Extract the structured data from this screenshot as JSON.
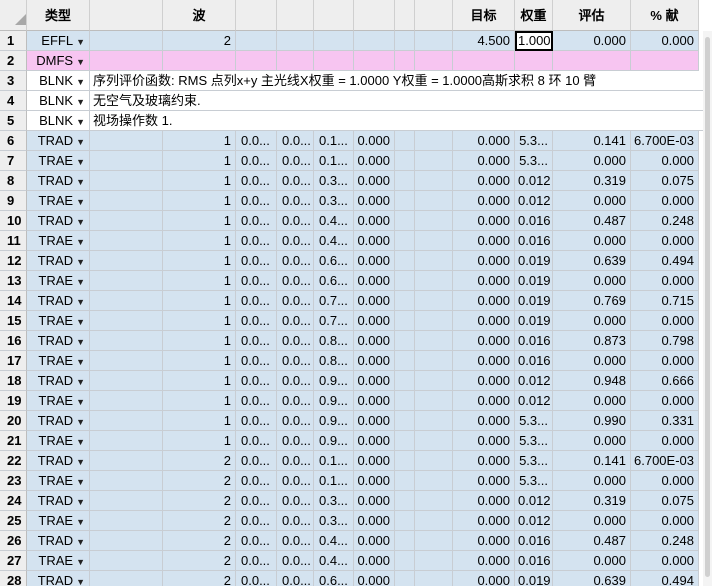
{
  "columns": {
    "type": "类型",
    "wave": "波",
    "target": "目标",
    "weight": "权重",
    "value": "评估",
    "contrib": "% 献"
  },
  "colors": {
    "header_bg": "#eeeeee",
    "operand_row_bg": "#d4e3f0",
    "effl_row_bg": "#d4e3f0",
    "dmfs_row_bg": "#f7c5f1",
    "blnk_row_bg": "#ffffff",
    "grid_line": "#c8cdd3"
  },
  "rows": [
    {
      "n": "1",
      "type": "EFFL",
      "style": "effl",
      "wave": "2",
      "c1": "",
      "c2": "",
      "c3": "",
      "c4": "",
      "target": "4.500",
      "weight": "1.000",
      "value": "0.000",
      "contrib": "0.000",
      "selected": "weight"
    },
    {
      "n": "2",
      "type": "DMFS",
      "style": "dmfs",
      "wave": "",
      "c1": "",
      "c2": "",
      "c3": "",
      "c4": "",
      "target": "",
      "weight": "",
      "value": "",
      "contrib": ""
    },
    {
      "n": "3",
      "type": "BLNK",
      "style": "blnk",
      "text": "序列评价函数: RMS 点列x+y 主光线X权重 = 1.0000 Y权重 = 1.0000高斯求积 8 环 10 臂"
    },
    {
      "n": "4",
      "type": "BLNK",
      "style": "blnk",
      "text": "无空气及玻璃约束."
    },
    {
      "n": "5",
      "type": "BLNK",
      "style": "blnk",
      "text": "视场操作数 1."
    },
    {
      "n": "6",
      "type": "TRAD",
      "style": "op",
      "wave": "1",
      "c1": "0.0...",
      "c2": "0.0...",
      "c3": "0.1...",
      "c4": "0.000",
      "target": "0.000",
      "weight": "5.3...",
      "value": "0.141",
      "contrib": "6.700E-03"
    },
    {
      "n": "7",
      "type": "TRAE",
      "style": "op",
      "wave": "1",
      "c1": "0.0...",
      "c2": "0.0...",
      "c3": "0.1...",
      "c4": "0.000",
      "target": "0.000",
      "weight": "5.3...",
      "value": "0.000",
      "contrib": "0.000"
    },
    {
      "n": "8",
      "type": "TRAD",
      "style": "op",
      "wave": "1",
      "c1": "0.0...",
      "c2": "0.0...",
      "c3": "0.3...",
      "c4": "0.000",
      "target": "0.000",
      "weight": "0.012",
      "value": "0.319",
      "contrib": "0.075"
    },
    {
      "n": "9",
      "type": "TRAE",
      "style": "op",
      "wave": "1",
      "c1": "0.0...",
      "c2": "0.0...",
      "c3": "0.3...",
      "c4": "0.000",
      "target": "0.000",
      "weight": "0.012",
      "value": "0.000",
      "contrib": "0.000"
    },
    {
      "n": "10",
      "type": "TRAD",
      "style": "op",
      "wave": "1",
      "c1": "0.0...",
      "c2": "0.0...",
      "c3": "0.4...",
      "c4": "0.000",
      "target": "0.000",
      "weight": "0.016",
      "value": "0.487",
      "contrib": "0.248"
    },
    {
      "n": "11",
      "type": "TRAE",
      "style": "op",
      "wave": "1",
      "c1": "0.0...",
      "c2": "0.0...",
      "c3": "0.4...",
      "c4": "0.000",
      "target": "0.000",
      "weight": "0.016",
      "value": "0.000",
      "contrib": "0.000"
    },
    {
      "n": "12",
      "type": "TRAD",
      "style": "op",
      "wave": "1",
      "c1": "0.0...",
      "c2": "0.0...",
      "c3": "0.6...",
      "c4": "0.000",
      "target": "0.000",
      "weight": "0.019",
      "value": "0.639",
      "contrib": "0.494"
    },
    {
      "n": "13",
      "type": "TRAE",
      "style": "op",
      "wave": "1",
      "c1": "0.0...",
      "c2": "0.0...",
      "c3": "0.6...",
      "c4": "0.000",
      "target": "0.000",
      "weight": "0.019",
      "value": "0.000",
      "contrib": "0.000"
    },
    {
      "n": "14",
      "type": "TRAD",
      "style": "op",
      "wave": "1",
      "c1": "0.0...",
      "c2": "0.0...",
      "c3": "0.7...",
      "c4": "0.000",
      "target": "0.000",
      "weight": "0.019",
      "value": "0.769",
      "contrib": "0.715"
    },
    {
      "n": "15",
      "type": "TRAE",
      "style": "op",
      "wave": "1",
      "c1": "0.0...",
      "c2": "0.0...",
      "c3": "0.7...",
      "c4": "0.000",
      "target": "0.000",
      "weight": "0.019",
      "value": "0.000",
      "contrib": "0.000"
    },
    {
      "n": "16",
      "type": "TRAD",
      "style": "op",
      "wave": "1",
      "c1": "0.0...",
      "c2": "0.0...",
      "c3": "0.8...",
      "c4": "0.000",
      "target": "0.000",
      "weight": "0.016",
      "value": "0.873",
      "contrib": "0.798"
    },
    {
      "n": "17",
      "type": "TRAE",
      "style": "op",
      "wave": "1",
      "c1": "0.0...",
      "c2": "0.0...",
      "c3": "0.8...",
      "c4": "0.000",
      "target": "0.000",
      "weight": "0.016",
      "value": "0.000",
      "contrib": "0.000"
    },
    {
      "n": "18",
      "type": "TRAD",
      "style": "op",
      "wave": "1",
      "c1": "0.0...",
      "c2": "0.0...",
      "c3": "0.9...",
      "c4": "0.000",
      "target": "0.000",
      "weight": "0.012",
      "value": "0.948",
      "contrib": "0.666"
    },
    {
      "n": "19",
      "type": "TRAE",
      "style": "op",
      "wave": "1",
      "c1": "0.0...",
      "c2": "0.0...",
      "c3": "0.9...",
      "c4": "0.000",
      "target": "0.000",
      "weight": "0.012",
      "value": "0.000",
      "contrib": "0.000"
    },
    {
      "n": "20",
      "type": "TRAD",
      "style": "op",
      "wave": "1",
      "c1": "0.0...",
      "c2": "0.0...",
      "c3": "0.9...",
      "c4": "0.000",
      "target": "0.000",
      "weight": "5.3...",
      "value": "0.990",
      "contrib": "0.331"
    },
    {
      "n": "21",
      "type": "TRAE",
      "style": "op",
      "wave": "1",
      "c1": "0.0...",
      "c2": "0.0...",
      "c3": "0.9...",
      "c4": "0.000",
      "target": "0.000",
      "weight": "5.3...",
      "value": "0.000",
      "contrib": "0.000"
    },
    {
      "n": "22",
      "type": "TRAD",
      "style": "op",
      "wave": "2",
      "c1": "0.0...",
      "c2": "0.0...",
      "c3": "0.1...",
      "c4": "0.000",
      "target": "0.000",
      "weight": "5.3...",
      "value": "0.141",
      "contrib": "6.700E-03"
    },
    {
      "n": "23",
      "type": "TRAE",
      "style": "op",
      "wave": "2",
      "c1": "0.0...",
      "c2": "0.0...",
      "c3": "0.1...",
      "c4": "0.000",
      "target": "0.000",
      "weight": "5.3...",
      "value": "0.000",
      "contrib": "0.000"
    },
    {
      "n": "24",
      "type": "TRAD",
      "style": "op",
      "wave": "2",
      "c1": "0.0...",
      "c2": "0.0...",
      "c3": "0.3...",
      "c4": "0.000",
      "target": "0.000",
      "weight": "0.012",
      "value": "0.319",
      "contrib": "0.075"
    },
    {
      "n": "25",
      "type": "TRAE",
      "style": "op",
      "wave": "2",
      "c1": "0.0...",
      "c2": "0.0...",
      "c3": "0.3...",
      "c4": "0.000",
      "target": "0.000",
      "weight": "0.012",
      "value": "0.000",
      "contrib": "0.000"
    },
    {
      "n": "26",
      "type": "TRAD",
      "style": "op",
      "wave": "2",
      "c1": "0.0...",
      "c2": "0.0...",
      "c3": "0.4...",
      "c4": "0.000",
      "target": "0.000",
      "weight": "0.016",
      "value": "0.487",
      "contrib": "0.248"
    },
    {
      "n": "27",
      "type": "TRAE",
      "style": "op",
      "wave": "2",
      "c1": "0.0...",
      "c2": "0.0...",
      "c3": "0.4...",
      "c4": "0.000",
      "target": "0.000",
      "weight": "0.016",
      "value": "0.000",
      "contrib": "0.000"
    },
    {
      "n": "28",
      "type": "TRAD",
      "style": "op",
      "wave": "2",
      "c1": "0.0...",
      "c2": "0.0...",
      "c3": "0.6...",
      "c4": "0.000",
      "target": "0.000",
      "weight": "0.019",
      "value": "0.639",
      "contrib": "0.494"
    }
  ]
}
